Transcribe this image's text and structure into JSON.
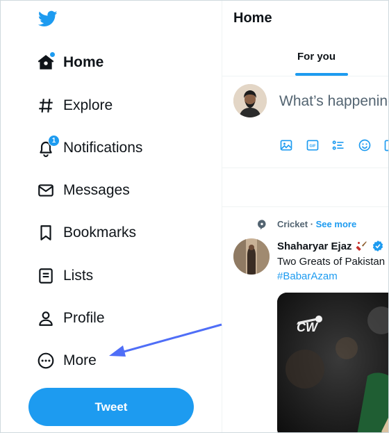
{
  "sidebar": {
    "items": [
      {
        "label": "Home",
        "icon": "home-icon",
        "active": true
      },
      {
        "label": "Explore",
        "icon": "hashtag-icon"
      },
      {
        "label": "Notifications",
        "icon": "bell-icon",
        "badge": "1"
      },
      {
        "label": "Messages",
        "icon": "envelope-icon"
      },
      {
        "label": "Bookmarks",
        "icon": "bookmark-icon"
      },
      {
        "label": "Lists",
        "icon": "list-icon"
      },
      {
        "label": "Profile",
        "icon": "person-icon"
      },
      {
        "label": "More",
        "icon": "more-circle-icon"
      }
    ],
    "tweet_button": "Tweet"
  },
  "main": {
    "title": "Home",
    "tabs": [
      {
        "label": "For you",
        "selected": true
      }
    ],
    "compose": {
      "placeholder": "What’s happening?"
    },
    "tweet": {
      "topic": "Cricket",
      "separator": " · ",
      "see_more": "See more",
      "author": "Shaharyar Ejaz",
      "text": "Two Greats of Pakistan",
      "hashtag": "#BabarAzam"
    }
  },
  "colors": {
    "accent": "#1d9bf0",
    "text": "#0f1419",
    "muted": "#536471",
    "annotation_arrow": "#4f6ef7"
  }
}
